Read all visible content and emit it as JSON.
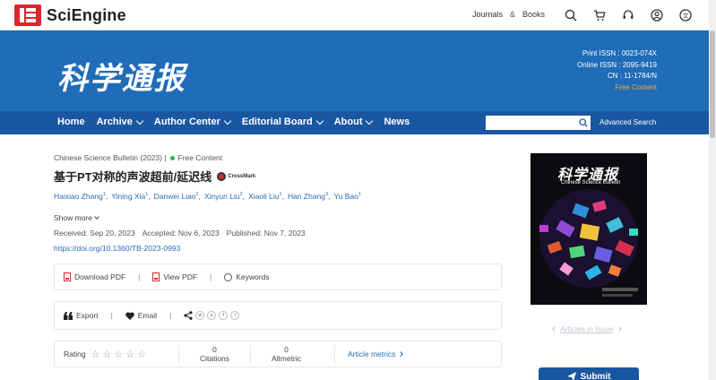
{
  "brand": {
    "name": "SciEngine"
  },
  "topnav": {
    "journals": "Journals",
    "amp": "&",
    "books": "Books"
  },
  "banner": {
    "journal_title": "科学通报",
    "print_issn": "Print ISSN : 0023-074X",
    "online_issn": "Online ISSN : 2095-9419",
    "cn": "CN : 11-1784/N",
    "free_content": "Free Content"
  },
  "mainnav": {
    "items": [
      "Home",
      "Archive",
      "Author Center",
      "Editorial Board",
      "About",
      "News"
    ],
    "search_placeholder": "",
    "advanced_search": "Advanced Search"
  },
  "article": {
    "journal_year": "Chinese Science Bulletin (2023) |",
    "access": "Free Content",
    "title": "基于PT对称的声波超前/延迟线",
    "crossmark": "CrossMark",
    "authors": [
      {
        "name": "Haixiao Zhang",
        "sup": "1"
      },
      {
        "name": "Yining Xia",
        "sup": "1"
      },
      {
        "name": "Danwei Liao",
        "sup": "2"
      },
      {
        "name": "Xinyun Liu",
        "sup": "2"
      },
      {
        "name": "Xiaoli Liu",
        "sup": "1"
      },
      {
        "name": "Han Zhang",
        "sup": "3"
      },
      {
        "name": "Yu Bao",
        "sup": "1"
      }
    ],
    "show_more": "Show more",
    "received": "Received: Sep 20, 2023",
    "accepted": "Accepted: Nov 6, 2023",
    "published": "Published: Nov 7, 2023",
    "doi": "https://doi.org/10.1360/TB-2023-0993"
  },
  "actions": {
    "download_pdf": "Download PDF",
    "view_pdf": "View PDF",
    "keywords": "Keywords",
    "sep": "|",
    "export": "Export",
    "email": "Email"
  },
  "metrics": {
    "rating_label": "Rating",
    "citations_value": "0",
    "citations_label": "Citations",
    "altmetric_value": "0",
    "altmetric_label": "Altmetric",
    "article_metrics": "Article metrics"
  },
  "cover": {
    "title": "科学通报",
    "subtitle": "Chinese Science Bulletin"
  },
  "sidebar": {
    "articles_in_issue": "Articles in Issue",
    "submit": "Submit"
  },
  "colors": {
    "banner": "#1f6cb8",
    "nav": "#1a57a3",
    "link": "#2a6ab8",
    "free": "#f3a83b",
    "brand_red": "#d9272e"
  }
}
